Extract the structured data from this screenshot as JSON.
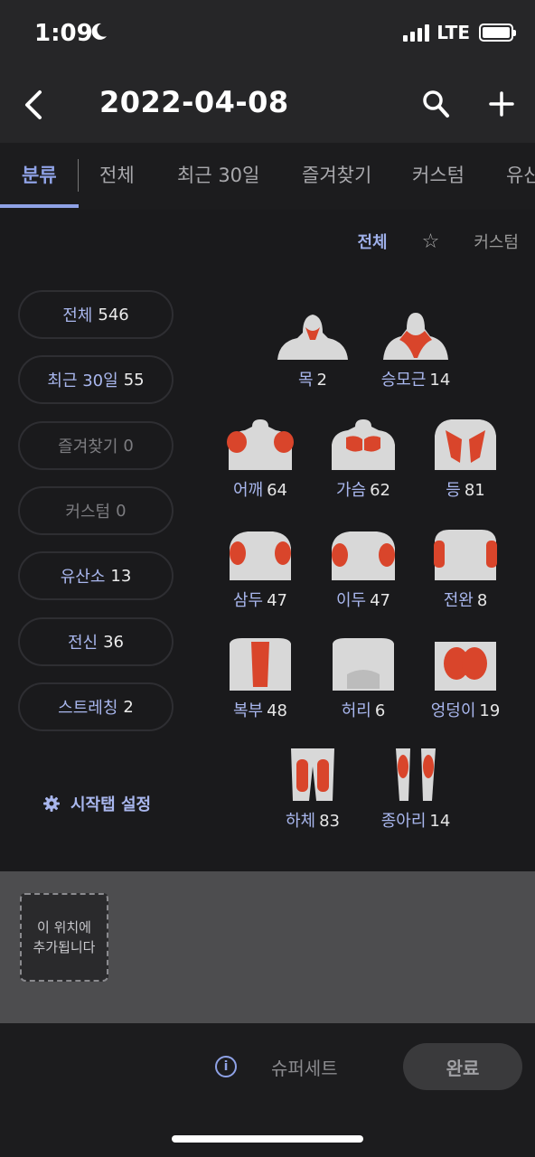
{
  "status": {
    "time": "1:09",
    "network": "LTE"
  },
  "header": {
    "title": "2022-04-08"
  },
  "tabs": [
    {
      "label": "분류",
      "active": true
    },
    {
      "label": "전체"
    },
    {
      "label": "최근 30일"
    },
    {
      "label": "즐겨찾기"
    },
    {
      "label": "커스텀"
    },
    {
      "label": "유산"
    }
  ],
  "filter": {
    "all": "전체",
    "star": "☆",
    "custom": "커스텀"
  },
  "categories": [
    {
      "label": "전체",
      "count": "546"
    },
    {
      "label": "최근 30일",
      "count": "55"
    },
    {
      "label": "즐겨찾기",
      "count": "0"
    },
    {
      "label": "커스텀",
      "count": "0"
    },
    {
      "label": "유산소",
      "count": "13"
    },
    {
      "label": "전신",
      "count": "36"
    },
    {
      "label": "스트레칭",
      "count": "2"
    }
  ],
  "settings_label": "시작탭 설정",
  "muscles": [
    {
      "name": "목",
      "count": "2"
    },
    {
      "name": "승모근",
      "count": "14"
    },
    {
      "name": "어깨",
      "count": "64"
    },
    {
      "name": "가슴",
      "count": "62"
    },
    {
      "name": "등",
      "count": "81"
    },
    {
      "name": "삼두",
      "count": "47"
    },
    {
      "name": "이두",
      "count": "47"
    },
    {
      "name": "전완",
      "count": "8"
    },
    {
      "name": "복부",
      "count": "48"
    },
    {
      "name": "허리",
      "count": "6"
    },
    {
      "name": "엉덩이",
      "count": "19"
    },
    {
      "name": "하체",
      "count": "83"
    },
    {
      "name": "종아리",
      "count": "14"
    }
  ],
  "tray": {
    "placeholder_line1": "이 위치에",
    "placeholder_line2": "추가됩니다"
  },
  "bottom": {
    "info": "i",
    "superset": "슈퍼세트",
    "done": "완료"
  },
  "colors": {
    "accent": "#8fa2e6",
    "muscle_highlight": "#d9452b",
    "body": "#d8d8d8"
  }
}
